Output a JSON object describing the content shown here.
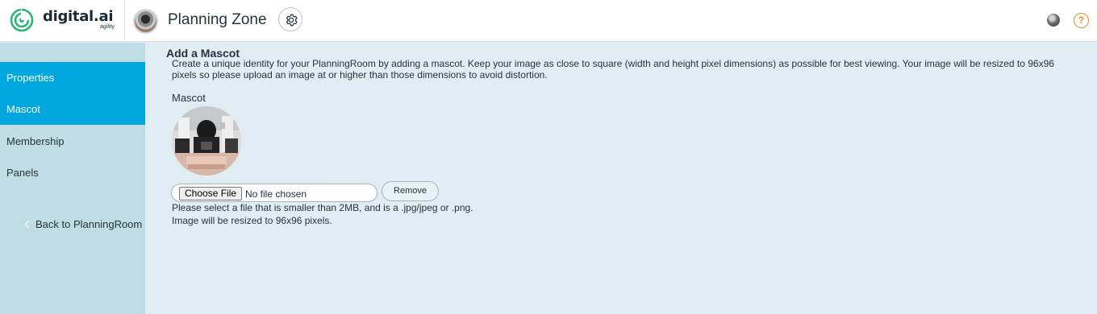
{
  "header": {
    "logo_text": "digital.ai",
    "logo_sub": "agility",
    "room_title": "Planning Zone"
  },
  "icons": {
    "logo": "digital-ai-logo",
    "settings": "gear-icon",
    "help": "question-icon",
    "back": "chevron-left-icon"
  },
  "colors": {
    "active_nav": "#00a7df",
    "sidebar": "#c0dde6",
    "main_bg": "#e0eef3",
    "help_accent": "#f08a1c",
    "logo_green": "#2bb673"
  },
  "sidebar": {
    "items": [
      {
        "label": "Properties",
        "state": "highlighted"
      },
      {
        "label": "Mascot",
        "state": "active"
      },
      {
        "label": "Membership",
        "state": "normal"
      },
      {
        "label": "Panels",
        "state": "normal"
      }
    ],
    "back_label": "Back to PlanningRoom"
  },
  "main": {
    "title": "Add a Mascot",
    "description": "Create a unique identity for your PlanningRoom by adding a mascot. Keep your image as close to square (width and height pixel dimensions) as possible for best viewing. Your image will be resized to 96x96 pixels so please upload an image at or higher than those dimensions to avoid distortion.",
    "field_label": "Mascot",
    "choose_file_label": "Choose File",
    "file_status": "No file chosen",
    "remove_label": "Remove",
    "hint_1": "Please select a file that is smaller than 2MB, and is a .jpg/jpeg or .png.",
    "hint_2": "Image will be resized to 96x96 pixels."
  }
}
